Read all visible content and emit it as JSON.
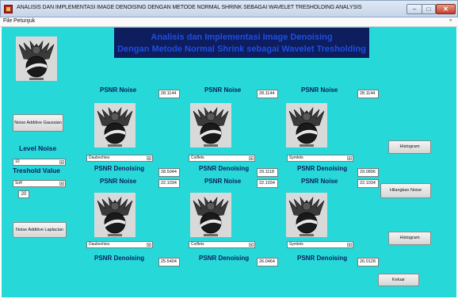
{
  "window": {
    "title": "ANALISIS DAN IMPLEMENTASI IMAGE DENOISING DENGAN METODE NORMAL SHRINK SEBAGAI WAVELET TRESHOLDING ANALYSIS",
    "min_label": "–",
    "max_label": "□",
    "close_label": "✕"
  },
  "menu": {
    "file": "File",
    "help": "Petunjuk",
    "overflow": "»"
  },
  "banner": {
    "line1": "Analisis dan Implementasi Image Denoising",
    "line2": "Dengan Metode Normal Shrink sebagai Wavelet Tresholding"
  },
  "left_panel": {
    "gaussian_button": "Noise Additive Gaussian",
    "level_noise_label": "Level Noise",
    "level_noise_value": "10",
    "threshold_label": "Treshold Value",
    "threshold_value": "Soft",
    "threshold_number": "20",
    "laplacian_button": "Noise Additive Laplacian"
  },
  "gaussian_row": [
    {
      "psnr_noise_label": "PSNR Noise",
      "psnr_noise": "28.1144",
      "wavelet": "Daubechies",
      "psnr_denoise_label": "PSNR Denoising",
      "psnr_denoise": "28.5044"
    },
    {
      "psnr_noise_label": "PSNR Noise",
      "psnr_noise": "28.1144",
      "wavelet": "Coiflets",
      "psnr_denoise_label": "PSNR Denoising",
      "psnr_denoise": "29.1118"
    },
    {
      "psnr_noise_label": "PSNR Noise",
      "psnr_noise": "28.1144",
      "wavelet": "Symlets",
      "psnr_denoise_label": "PSNR Denoising",
      "psnr_denoise": "29.0896"
    }
  ],
  "laplacian_row": [
    {
      "psnr_noise_label": "PSNR Noise",
      "psnr_noise": "22.1034",
      "wavelet": "Daubechies",
      "psnr_denoise_label": "PSNR Denoising",
      "psnr_denoise": "25.5404"
    },
    {
      "psnr_noise_label": "PSNR Noise",
      "psnr_noise": "22.1034",
      "wavelet": "Coiflets",
      "psnr_denoise_label": "PSNR Denoising",
      "psnr_denoise": "26.0464"
    },
    {
      "psnr_noise_label": "PSNR Noise",
      "psnr_noise": "22.1034",
      "wavelet": "Symlets",
      "psnr_denoise_label": "PSNR Denoising",
      "psnr_denoise": "26.0128"
    }
  ],
  "right_panel": {
    "histogram_top": "Histogram",
    "remove_noise": "Hilangkan Noise",
    "histogram_bottom": "Histogram",
    "exit": "Keluar"
  },
  "colors": {
    "background": "#27d8d8",
    "banner_bg": "#0d1d5e",
    "banner_text": "#1e4fe0",
    "label_text": "#0d1d5e"
  }
}
